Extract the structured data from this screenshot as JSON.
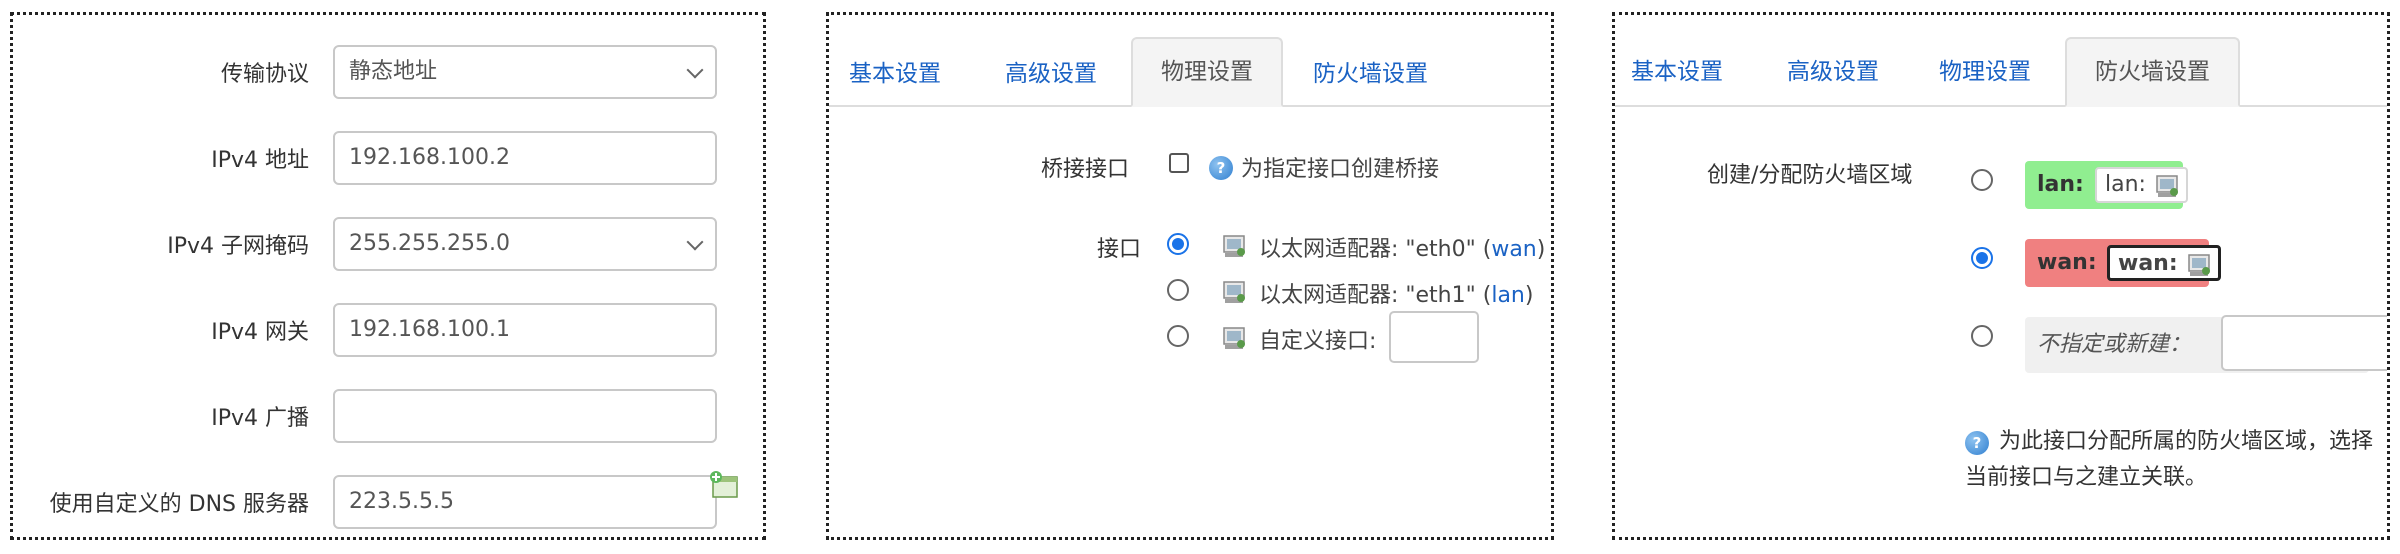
{
  "panel1": {
    "rows": [
      {
        "label": "传输协议",
        "value": "静态地址",
        "type": "select"
      },
      {
        "label": "IPv4 地址",
        "value": "192.168.100.2",
        "type": "text"
      },
      {
        "label": "IPv4 子网掩码",
        "value": "255.255.255.0",
        "type": "select"
      },
      {
        "label": "IPv4 网关",
        "value": "192.168.100.1",
        "type": "text"
      },
      {
        "label": "IPv4 广播",
        "value": "",
        "type": "text"
      },
      {
        "label": "使用自定义的 DNS 服务器",
        "value": "223.5.5.5",
        "type": "text"
      }
    ],
    "add_icon": "add-entry-icon"
  },
  "tabs": [
    "基本设置",
    "高级设置",
    "物理设置",
    "防火墙设置"
  ],
  "panel2": {
    "active_tab": "物理设置",
    "bridge_label": "桥接接口",
    "bridge_desc": "为指定接口创建桥接",
    "bridge_checked": false,
    "iface_label": "接口",
    "ifaces": [
      {
        "text": "以太网适配器: \"eth0\"",
        "net": "wan",
        "selected": true
      },
      {
        "text": "以太网适配器: \"eth1\"",
        "net": "lan",
        "selected": false
      },
      {
        "text": "自定义接口:",
        "net": "",
        "selected": false
      }
    ]
  },
  "panel3": {
    "active_tab": "防火墙设置",
    "zone_label": "创建/分配防火墙区域",
    "zones": [
      {
        "name": "lan:",
        "net": "lan:",
        "color": "#90ee90",
        "selected": false
      },
      {
        "name": "wan:",
        "net": "wan:",
        "color": "#f08080",
        "selected": true
      }
    ],
    "new_zone_placeholder": "不指定或新建：",
    "help_line1": "为此接口分配所属的防火墙区域，选择",
    "help_line2": "当前接口与之建立关联。"
  },
  "icons": {
    "help": "help-icon",
    "nic": "network-adapter-icon"
  }
}
